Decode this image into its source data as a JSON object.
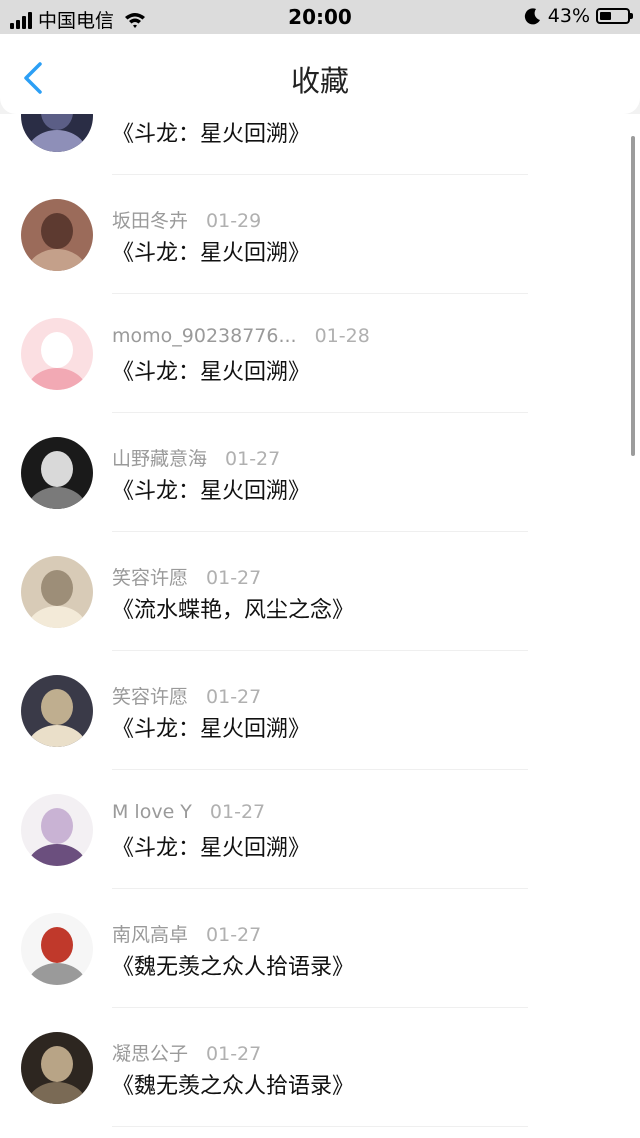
{
  "status": {
    "carrier": "中国电信",
    "time": "20:00",
    "battery": "43%",
    "battery_level": 0.43
  },
  "nav": {
    "title": "收藏",
    "back_icon": "chevron-left-icon",
    "accent": "#2c9ff5"
  },
  "items": [
    {
      "user": "",
      "date": "",
      "book": "《斗龙：星火回溯》",
      "avatar_colors": [
        "#2a2d45",
        "#8e8fb8",
        "#5b5e86"
      ]
    },
    {
      "user": "坂田冬卉",
      "date": "01-29",
      "book": "《斗龙：星火回溯》",
      "avatar_colors": [
        "#9b6b5a",
        "#c4a08a",
        "#5d3a30"
      ]
    },
    {
      "user": "momo_90238776...",
      "date": "01-28",
      "book": "《斗龙：星火回溯》",
      "avatar_colors": [
        "#fbdfe2",
        "#f2a9b4",
        "#ffffff"
      ]
    },
    {
      "user": "山野藏意海",
      "date": "01-27",
      "book": "《斗龙：星火回溯》",
      "avatar_colors": [
        "#1a1a1a",
        "#7a7a7a",
        "#d9d9d9"
      ]
    },
    {
      "user": "笑容许愿",
      "date": "01-27",
      "book": "《流水蝶艳，风尘之念》",
      "avatar_colors": [
        "#d8cbb7",
        "#f3ead8",
        "#9d8e78"
      ]
    },
    {
      "user": "笑容许愿",
      "date": "01-27",
      "book": "《斗龙：星火回溯》",
      "avatar_colors": [
        "#3a3a48",
        "#eadfc9",
        "#bfae8f"
      ]
    },
    {
      "user": "M love Y",
      "date": "01-27",
      "book": "《斗龙：星火回溯》",
      "avatar_colors": [
        "#f3f0f3",
        "#6b4f7e",
        "#c9b3d4"
      ]
    },
    {
      "user": "南风高卓",
      "date": "01-27",
      "book": "《魏无羡之众人拾语录》",
      "avatar_colors": [
        "#f6f6f6",
        "#9a9a9a",
        "#c0392b"
      ]
    },
    {
      "user": "凝思公子",
      "date": "01-27",
      "book": "《魏无羡之众人拾语录》",
      "avatar_colors": [
        "#2d2620",
        "#7a6a55",
        "#b8a486"
      ]
    }
  ]
}
